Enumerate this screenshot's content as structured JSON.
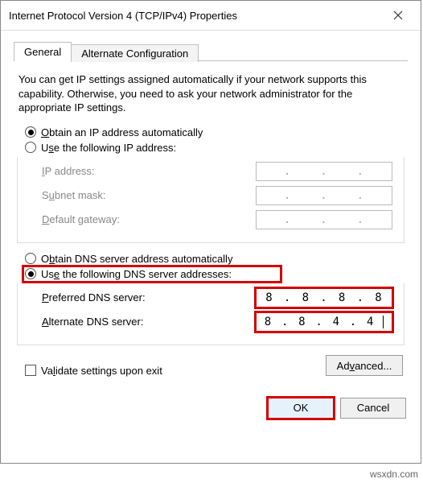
{
  "window": {
    "title": "Internet Protocol Version 4 (TCP/IPv4) Properties"
  },
  "tabs": {
    "general": "General",
    "alternate": "Alternate Configuration"
  },
  "description": "You can get IP settings assigned automatically if your network supports this capability. Otherwise, you need to ask your network administrator for the appropriate IP settings.",
  "ip_section": {
    "auto_label_pre": "O",
    "auto_label_rest": "btain an IP address automatically",
    "manual_label_pre": "U",
    "manual_label_rest1": "se the following IP address:",
    "ip_address_pre": "I",
    "ip_address_rest": "P address:",
    "subnet_pre": "S",
    "subnet_rest": "ubnet mask:",
    "gateway_pre": "D",
    "gateway_rest": "efault gateway:"
  },
  "dns_section": {
    "auto_label_pre": "O",
    "auto_label_rest": "btain DNS server address automatically",
    "manual_label_pre": "Us",
    "manual_label_u": "e",
    "manual_label_rest": " the following DNS server addresses:",
    "preferred_pre": "P",
    "preferred_rest": "referred DNS server:",
    "alternate_pre": "A",
    "alternate_rest": "lternate DNS server:",
    "preferred_value": {
      "a": "8",
      "b": "8",
      "c": "8",
      "d": "8"
    },
    "alternate_value": {
      "a": "8",
      "b": "8",
      "c": "4",
      "d": "4"
    }
  },
  "validate": {
    "pre": "V",
    "rest": "alidate settings upon exit"
  },
  "buttons": {
    "advanced_pre": "Ad",
    "advanced_u": "v",
    "advanced_rest": "anced...",
    "ok": "OK",
    "cancel": "Cancel"
  },
  "watermark": "wsxdn.com"
}
